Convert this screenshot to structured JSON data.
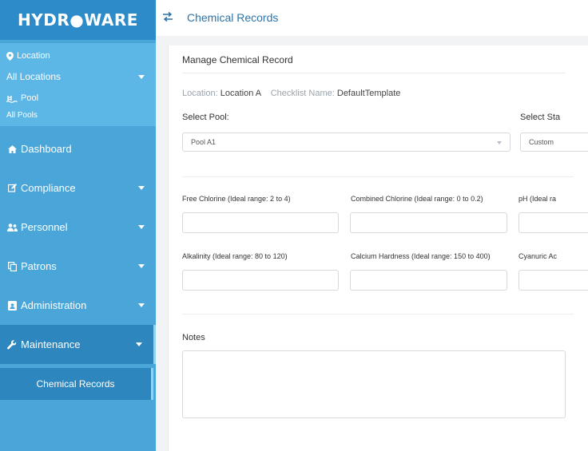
{
  "brand": {
    "logo_text": "HYDR●WARE"
  },
  "sidebar": {
    "location_label": "Location",
    "location_value": "All Locations",
    "pool_label": "Pool",
    "pool_value": "All Pools",
    "items": [
      {
        "label": "Dashboard",
        "icon": "home-icon",
        "has_caret": false
      },
      {
        "label": "Compliance",
        "icon": "edit-icon",
        "has_caret": true
      },
      {
        "label": "Personnel",
        "icon": "users-icon",
        "has_caret": true
      },
      {
        "label": "Patrons",
        "icon": "copy-icon",
        "has_caret": true
      },
      {
        "label": "Administration",
        "icon": "id-card-icon",
        "has_caret": true
      },
      {
        "label": "Maintenance",
        "icon": "wrench-icon",
        "has_caret": true,
        "active": true
      }
    ],
    "subitem": "Chemical Records"
  },
  "topbar": {
    "title": "Chemical Records"
  },
  "card": {
    "header": "Manage Chemical Record",
    "location_label": "Location:",
    "location_value": "Location A",
    "checklist_label": "Checklist Name:",
    "checklist_value": "DefaultTemplate",
    "select_pool_label": "Select Pool:",
    "select_pool_value": "Pool A1",
    "select_status_label": "Select Sta",
    "select_status_value": "Custom"
  },
  "fields": {
    "free_chlorine": "Free Chlorine (Ideal range: 2 to 4)",
    "combined_chlorine": "Combined Chlorine (Ideal range: 0 to 0.2)",
    "ph": "pH (Ideal ra",
    "alkalinity": "Alkalinity (Ideal range: 80 to 120)",
    "calcium_hardness": "Calcium Hardness (Ideal range: 150 to 400)",
    "cyanuric": "Cyanuric Ac"
  },
  "notes_label": "Notes",
  "colors": {
    "sidebar": "#4aa6d8",
    "logo_bar": "#2c8bc8",
    "location_block": "#5cb6e6",
    "active": "#2e86be",
    "title": "#2c73a8"
  }
}
